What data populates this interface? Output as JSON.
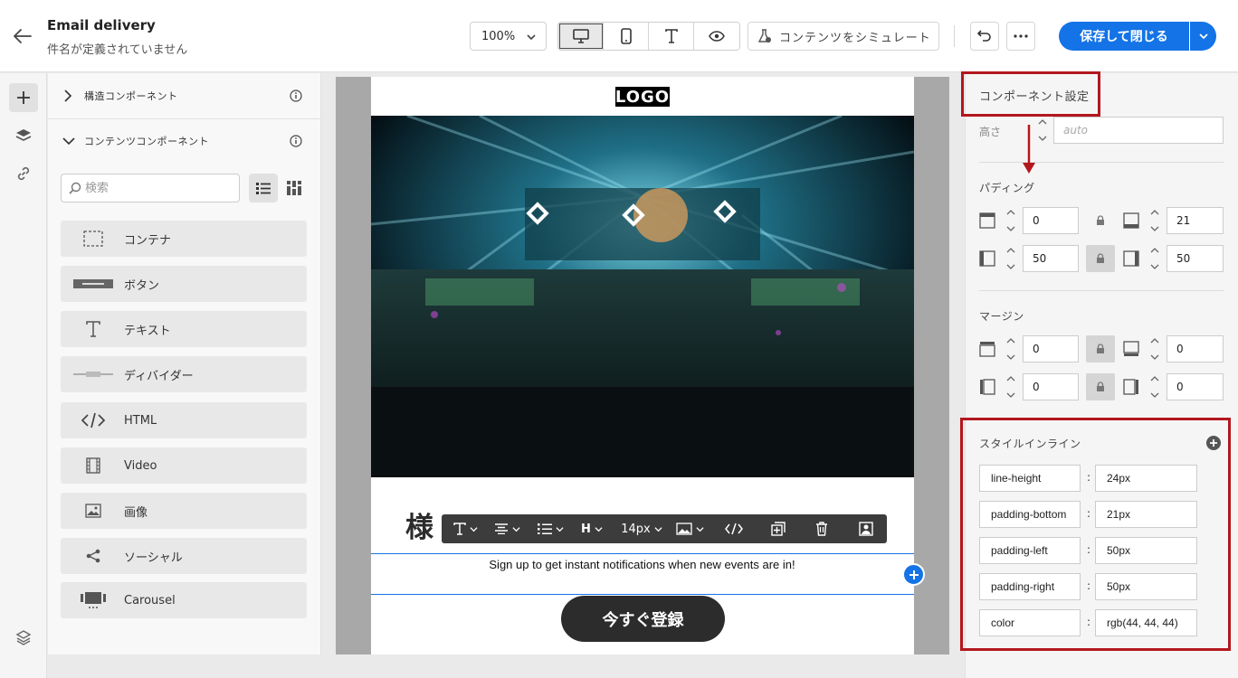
{
  "header": {
    "title": "Email delivery",
    "subtitle": "件名が定義されていません",
    "zoom": "100%",
    "simulate_label": "コンテンツをシミュレート",
    "save_label": "保存して閉じる"
  },
  "components_panel": {
    "structure_label": "構造コンポーネント",
    "content_label": "コンテンツコンポーネント",
    "search_placeholder": "検索",
    "items": [
      {
        "label": "コンテナ",
        "icon": "container-icon"
      },
      {
        "label": "ボタン",
        "icon": "button-icon"
      },
      {
        "label": "テキスト",
        "icon": "text-icon"
      },
      {
        "label": "ディバイダー",
        "icon": "divider-icon"
      },
      {
        "label": "HTML",
        "icon": "code-icon"
      },
      {
        "label": "Video",
        "icon": "video-icon"
      },
      {
        "label": "画像",
        "icon": "image-icon"
      },
      {
        "label": "ソーシャル",
        "icon": "share-icon"
      },
      {
        "label": "Carousel",
        "icon": "carousel-icon"
      }
    ]
  },
  "canvas": {
    "logo": "LOGO",
    "heading": "様",
    "body_text": "Sign up to get instant notifications when new events are in!",
    "cta_label": "今すぐ登録",
    "toolbar": {
      "heading_label": "H",
      "font_size": "14px"
    }
  },
  "settings_panel": {
    "title": "コンポーネント設定",
    "height_label": "高さ",
    "height_placeholder": "auto",
    "padding_label": "パディング",
    "padding": {
      "top": "0",
      "bottom": "21",
      "left": "50",
      "right": "50"
    },
    "margin_label": "マージン",
    "margin": {
      "top": "0",
      "bottom": "0",
      "left": "0",
      "right": "0"
    },
    "style_inline_label": "スタイルインライン",
    "styles": [
      {
        "key": "line-height",
        "value": "24px"
      },
      {
        "key": "padding-bottom",
        "value": "21px"
      },
      {
        "key": "padding-left",
        "value": "50px"
      },
      {
        "key": "padding-right",
        "value": "50px"
      },
      {
        "key": "color",
        "value": "rgb(44, 44, 44)"
      }
    ]
  },
  "colors": {
    "accent": "#1473e6",
    "annotation": "#b3171e",
    "text": "#2c2c2c"
  }
}
